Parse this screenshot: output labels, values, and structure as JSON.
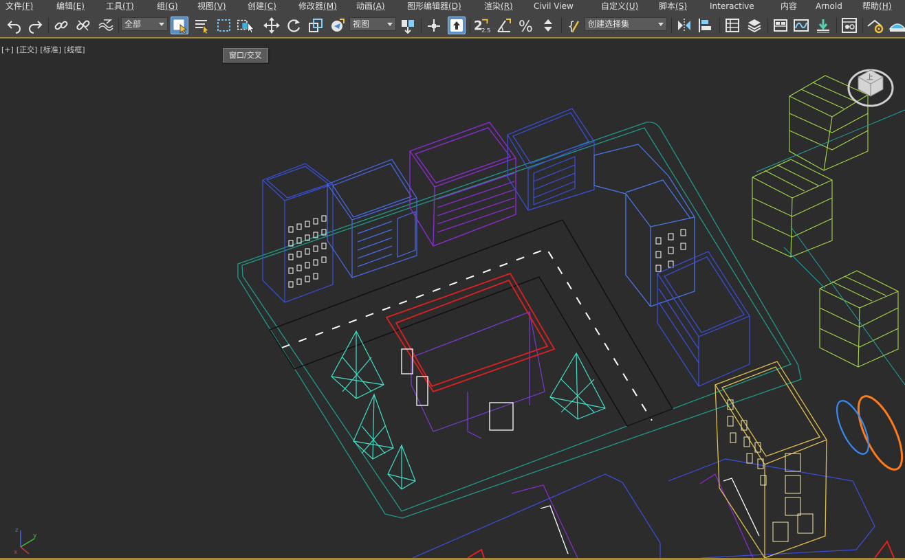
{
  "menu": [
    {
      "label": "文件",
      "key": "(F)"
    },
    {
      "label": "编辑",
      "key": "(E)"
    },
    {
      "label": "工具",
      "key": "(T)"
    },
    {
      "label": "组",
      "key": "(G)"
    },
    {
      "label": "视图",
      "key": "(V)"
    },
    {
      "label": "创建",
      "key": "(C)"
    },
    {
      "label": "修改器",
      "key": "(M)"
    },
    {
      "label": "动画",
      "key": "(A)"
    },
    {
      "label": "图形编辑器",
      "key": "(D)"
    },
    {
      "label": "渲染",
      "key": "(R)"
    },
    {
      "label": "Civil View",
      "key": ""
    },
    {
      "label": "自定义",
      "key": "(U)"
    },
    {
      "label": "脚本",
      "key": "(S)"
    },
    {
      "label": "Interactive",
      "key": ""
    },
    {
      "label": "内容",
      "key": ""
    },
    {
      "label": "Arnold",
      "key": ""
    },
    {
      "label": "帮助",
      "key": "(H)"
    }
  ],
  "toolbar": {
    "selection_filter": "全部",
    "reference_coord": "视图",
    "named_selection_set": "创建选择集",
    "snap_label": "2.5",
    "icons": [
      "undo-icon",
      "redo-icon",
      "link-icon",
      "unlink-icon",
      "bind-space-warp-icon",
      "select-object-icon",
      "select-by-name-icon",
      "rectangular-selection-icon",
      "window-crossing-icon",
      "move-icon",
      "rotate-icon",
      "scale-icon",
      "placement-icon",
      "use-pivot-icon",
      "manipulate-icon",
      "snap-toggle-icon",
      "angle-snap-icon",
      "percent-snap-icon",
      "spinner-snap-icon",
      "edit-named-selection-icon",
      "mirror-icon",
      "align-icon",
      "scene-explorer-icon",
      "layer-explorer-icon",
      "ribbon-icon",
      "curve-editor-icon",
      "schematic-view-icon",
      "material-editor-icon",
      "render-setup-icon",
      "render-icon"
    ]
  },
  "viewport": {
    "labels": [
      "[+]",
      "[正交]",
      "[标准]",
      "[线框]"
    ],
    "tooltip": "窗口/交叉",
    "viewcube_label": "上",
    "axis_labels": {
      "x": "x",
      "y": "y",
      "z": "z"
    }
  },
  "colors": {
    "menubar_bg": "#444444",
    "viewport_bg": "#2c2c2c",
    "active_button": "#5d8ec2",
    "accent_border": "#a98a3a",
    "building_blue": "#3b4fe0",
    "building_purple": "#8a2bd0",
    "roof_red": "#e02020",
    "tree_cyan": "#40e0c8",
    "ground_teal": "#1f9a8a",
    "cube_green": "#a6d84a",
    "building_yellow": "#e0c050",
    "ring_orange": "#ff7a1a"
  }
}
